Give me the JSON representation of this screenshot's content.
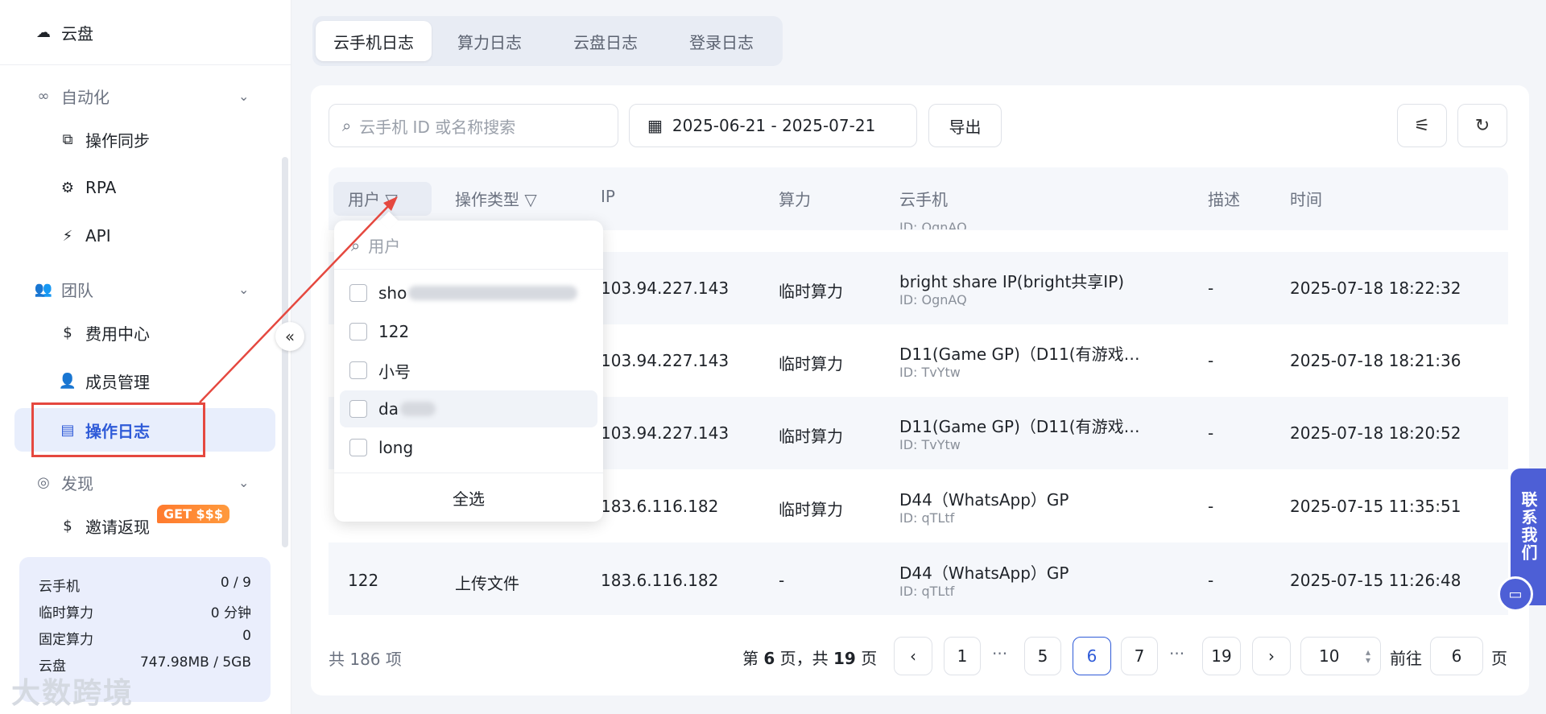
{
  "sidebar": {
    "top_item": "云盘",
    "sections": [
      {
        "label": "自动化",
        "items": [
          "操作同步",
          "RPA",
          "API"
        ]
      },
      {
        "label": "团队",
        "items": [
          "费用中心",
          "成员管理",
          "操作日志"
        ]
      },
      {
        "label": "发现",
        "items": [
          "邀请返现"
        ]
      }
    ],
    "badge": "GET $$$",
    "active_item": "操作日志"
  },
  "stats": [
    {
      "label": "云手机",
      "value": "0 / 9"
    },
    {
      "label": "临时算力",
      "value": "0 分钟"
    },
    {
      "label": "固定算力",
      "value": "0"
    },
    {
      "label": "云盘",
      "value": "747.98MB / 5GB"
    }
  ],
  "watermark": "大数跨境",
  "tabs": [
    "云手机日志",
    "算力日志",
    "云盘日志",
    "登录日志"
  ],
  "toolbar": {
    "search_placeholder": "云手机 ID 或名称搜索",
    "date_range": "2025-06-21 - 2025-07-21",
    "export_label": "导出"
  },
  "columns": [
    "用户",
    "操作类型",
    "IP",
    "算力",
    "云手机",
    "描述",
    "时间"
  ],
  "partial_row_sub": "ID: OgnAQ",
  "rows": [
    {
      "user": "",
      "type": "",
      "ip": "103.94.227.143",
      "power": "临时算力",
      "phone": "bright share IP(bright共享IP)",
      "phone_id": "ID: OgnAQ",
      "desc": "-",
      "time": "2025-07-18 18:22:32"
    },
    {
      "user": "",
      "type": "",
      "ip": "103.94.227.143",
      "power": "临时算力",
      "phone": "D11(Game GP)（D11(有游戏…",
      "phone_id": "ID: TvYtw",
      "desc": "-",
      "time": "2025-07-18 18:21:36"
    },
    {
      "user": "",
      "type": "",
      "ip": "103.94.227.143",
      "power": "临时算力",
      "phone": "D11(Game GP)（D11(有游戏…",
      "phone_id": "ID: TvYtw",
      "desc": "-",
      "time": "2025-07-18 18:20:52"
    },
    {
      "user": "",
      "type": "",
      "ip": "183.6.116.182",
      "power": "临时算力",
      "phone": "D44（WhatsApp）GP",
      "phone_id": "ID: qTLtf",
      "desc": "-",
      "time": "2025-07-15 11:35:51"
    },
    {
      "user": "122",
      "type": "上传文件",
      "ip": "183.6.116.182",
      "power": "-",
      "phone": "D44（WhatsApp）GP",
      "phone_id": "ID: qTLtf",
      "desc": "-",
      "time": "2025-07-15 11:26:48"
    }
  ],
  "filter_popup": {
    "search_placeholder": "用户",
    "options": [
      "sho",
      "122",
      "小号",
      "da",
      "long"
    ],
    "select_all": "全选"
  },
  "pagination": {
    "total": "共 186 项",
    "info_prefix": "第 ",
    "current_page": "6",
    "info_middle": " 页，共 ",
    "total_pages": "19",
    "info_suffix": " 页",
    "pages": [
      "1",
      "5",
      "6",
      "7",
      "19"
    ],
    "dots": "···",
    "page_size": "10",
    "goto_label": "前往",
    "goto_value": "6",
    "goto_suffix": "页"
  },
  "contact": "联系我们",
  "colors": {
    "accent": "#2f5bd8",
    "annotation": "#e5483f",
    "contact": "#4d5fd6"
  }
}
